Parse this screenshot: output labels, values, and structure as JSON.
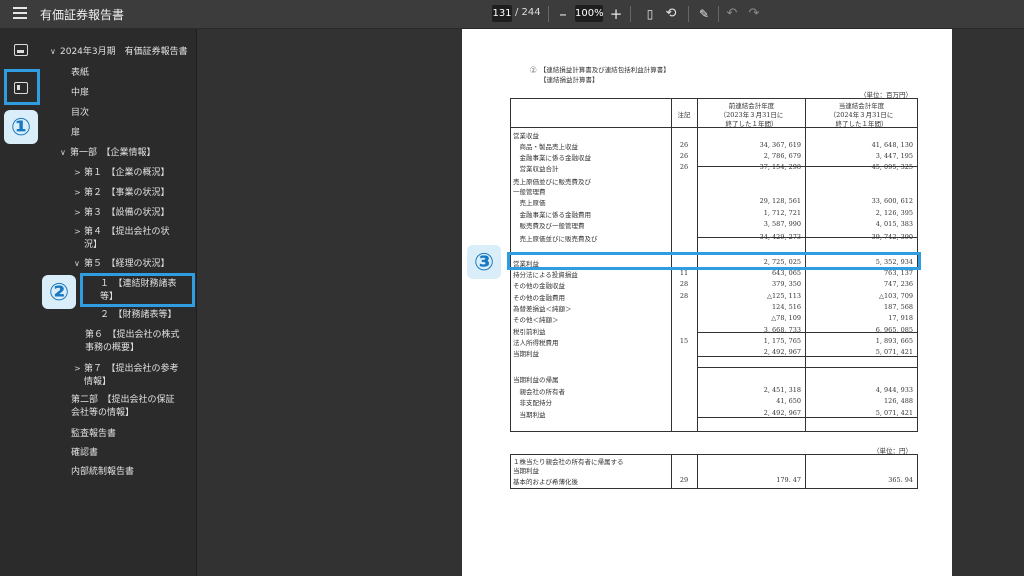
{
  "app": {
    "title": "有価証券報告書",
    "page_current": "131",
    "page_total": "/ 244",
    "zoom": "100%",
    "icons": [
      "menu-icon",
      "minus-icon",
      "plus-icon",
      "fit-page-icon",
      "rotate-icon",
      "draw-icon",
      "undo-icon",
      "redo-icon",
      "thumbnails-icon",
      "outline-icon"
    ]
  },
  "sidebar": {
    "items": [
      {
        "label": "2024年3月期　有価証券報告書",
        "chev": "∨"
      },
      {
        "label": "表紙"
      },
      {
        "label": "中扉"
      },
      {
        "label": "目次"
      },
      {
        "label": "扉"
      },
      {
        "label": "第一部　【企業情報】",
        "chev": "∨"
      },
      {
        "label": "第１　【企業の概況】",
        "chev": ">"
      },
      {
        "label": "第２　【事業の状況】",
        "chev": ">"
      },
      {
        "label": "第３　【設備の状況】",
        "chev": ">"
      },
      {
        "label": "第４　【提出会社の状",
        "label2": "況】",
        "chev": ">"
      },
      {
        "label": "第５　【経理の状況】",
        "chev": "∨"
      },
      {
        "label": "１　【連結財務諸表",
        "label2": "等】"
      },
      {
        "label": "２　【財務諸表等】"
      },
      {
        "label": "第６　【提出会社の株式",
        "label2": "事務の概要】"
      },
      {
        "label": "第７　【提出会社の参考",
        "label2": "情報】",
        "chev": ">"
      },
      {
        "label": "第二部　【提出会社の保証",
        "label2": "会社等の情報】"
      },
      {
        "label": "監査報告書"
      },
      {
        "label": "確認書"
      },
      {
        "label": "内部統制報告書"
      }
    ]
  },
  "badges": {
    "b1": "①",
    "b2": "②",
    "b3": "③"
  },
  "doc": {
    "heading1": "②　【連結損益計算書及び連結包括利益計算書】",
    "heading2": "【連結損益計算書】",
    "unit1": "（単位：百万円）",
    "col_note": "注記",
    "col_prev_1": "前連結会計年度",
    "col_prev_2": "（2023年３月31日に",
    "col_prev_3": "終了した１年間）",
    "col_curr_1": "当連結会計年度",
    "col_curr_2": "（2024年３月31日に",
    "col_curr_3": "終了した１年間）",
    "rows": [
      {
        "label": "営業収益",
        "note": "",
        "prev": "",
        "curr": ""
      },
      {
        "label": "　商品・製品売上収益",
        "note": "26",
        "prev": "34, 367, 619",
        "curr": "41, 648, 130"
      },
      {
        "label": "　金融事業に係る金融収益",
        "note": "26",
        "prev": "2, 786, 679",
        "curr": "3, 447, 195"
      },
      {
        "label": "　営業収益合計",
        "note": "26",
        "prev": "37, 154, 298",
        "curr": "45, 095, 325"
      },
      {
        "label": "売上原価並びに販売費及び",
        "note": "",
        "prev": "",
        "curr": ""
      },
      {
        "label": "一般管理費",
        "note": "",
        "prev": "",
        "curr": ""
      },
      {
        "label": "　売上原価",
        "note": "",
        "prev": "29, 128, 561",
        "curr": "33, 600, 612"
      },
      {
        "label": "　金融事業に係る金融費用",
        "note": "",
        "prev": "1, 712, 721",
        "curr": "2, 126, 395"
      },
      {
        "label": "　販売費及び一般管理費",
        "note": "",
        "prev": "3, 587, 990",
        "curr": "4, 015, 383"
      },
      {
        "label": "　売上原価並びに販売費及び",
        "note": "",
        "prev": "34, 429, 273",
        "curr": "39, 742, 390"
      },
      {
        "label": "営業利益",
        "note": "",
        "prev": "2, 725, 025",
        "curr": "5, 352, 934"
      },
      {
        "label": "持分法による投資損益",
        "note": "11",
        "prev": "643, 065",
        "curr": "763, 137"
      },
      {
        "label": "その他の金融収益",
        "note": "28",
        "prev": "379, 350",
        "curr": "747, 236"
      },
      {
        "label": "その他の金融費用",
        "note": "28",
        "prev": "△125, 113",
        "curr": "△103, 709"
      },
      {
        "label": "為替差損益＜純額＞",
        "note": "",
        "prev": "124, 516",
        "curr": "187, 568"
      },
      {
        "label": "その他＜純額＞",
        "note": "",
        "prev": "△78, 109",
        "curr": "17, 918"
      },
      {
        "label": "税引前利益",
        "note": "",
        "prev": "3, 668, 733",
        "curr": "6, 965, 085"
      },
      {
        "label": "法人所得税費用",
        "note": "15",
        "prev": "1, 175, 765",
        "curr": "1, 893, 665"
      },
      {
        "label": "当期利益",
        "note": "",
        "prev": "2, 492, 967",
        "curr": "5, 071, 421"
      },
      {
        "label": "当期利益の帰属",
        "note": "",
        "prev": "",
        "curr": ""
      },
      {
        "label": "　親会社の所有者",
        "note": "",
        "prev": "2, 451, 318",
        "curr": "4, 944, 933"
      },
      {
        "label": "　非支配持分",
        "note": "",
        "prev": "41, 650",
        "curr": "126, 488"
      },
      {
        "label": "　当期利益",
        "note": "",
        "prev": "2, 492, 967",
        "curr": "5, 071, 421"
      }
    ],
    "unit2": "（単位：円）",
    "eps_1": "１株当たり親会社の所有者に帰属する",
    "eps_2": "当期利益",
    "eps_3": "基本的および希薄化後",
    "eps_note": "29",
    "eps_prev": "179. 47",
    "eps_curr": "365. 94"
  }
}
